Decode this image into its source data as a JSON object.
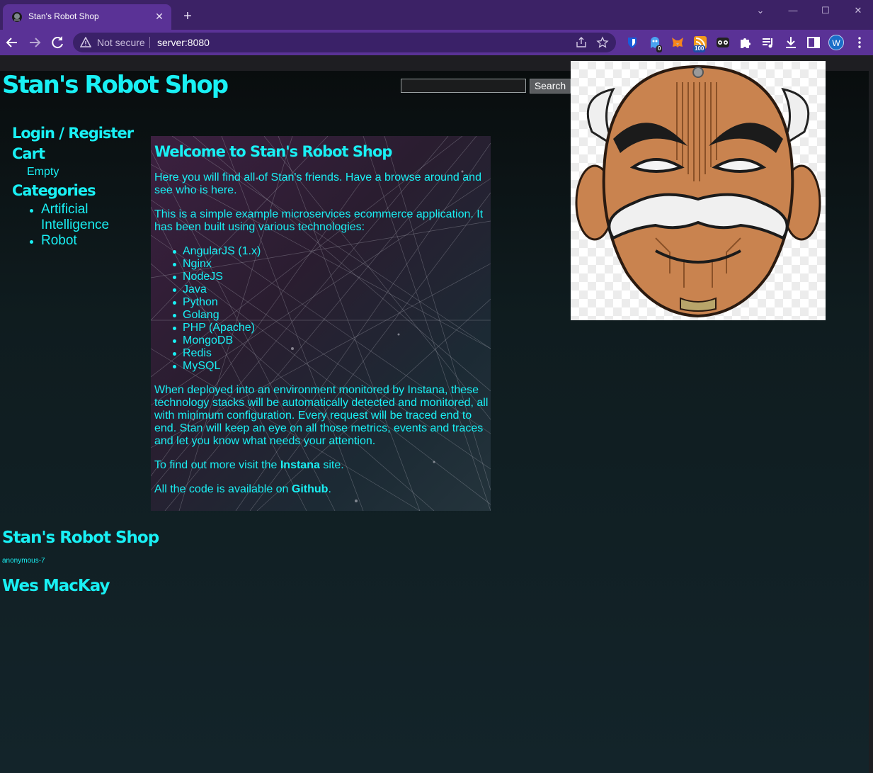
{
  "browser": {
    "tab_title": "Stan's Robot Shop",
    "security_label": "Not secure",
    "url": "server:8080",
    "profile_initial": "W",
    "extension_badges": {
      "ghostery": "0",
      "rss": "100"
    }
  },
  "header": {
    "title": "Stan's Robot Shop",
    "search_placeholder": "",
    "search_button": "Search"
  },
  "sidebar": {
    "login_label": "Login / Register",
    "cart_label": "Cart",
    "cart_status": "Empty",
    "categories_label": "Categories",
    "categories": [
      "Artificial Intelligence",
      "Robot"
    ]
  },
  "welcome": {
    "title": "Welcome to Stan's Robot Shop",
    "intro": "Here you will find all of Stan's friends. Have a browse around and see who is here.",
    "tech_intro": "This is a simple example microservices ecommerce application. It has been built using various technologies:",
    "technologies": [
      "AngularJS (1.x)",
      "Nginx",
      "NodeJS",
      "Java",
      "Python",
      "Golang",
      "PHP (Apache)",
      "MongoDB",
      "Redis",
      "MySQL"
    ],
    "monitoring": "When deployed into an environment monitored by Instana, these technology stacks will be automatically detected and monitored, all with minimum configuration. Every request will be traced end to end. Stan will keep an eye on all those metrics, events and traces and let you know what needs your attention.",
    "more_prefix": "To find out more visit the ",
    "more_link": "Instana",
    "more_suffix": " site.",
    "code_prefix": "All the code is available on ",
    "code_link": "Github",
    "code_suffix": "."
  },
  "footer": {
    "title": "Stan's Robot Shop",
    "user": "anonymous-7",
    "author": "Wes MacKay"
  },
  "colors": {
    "accent": "#19f0f4",
    "tab_bar": "#3c2266",
    "toolbar": "#5a3296",
    "mask_copper": "#c9834f"
  }
}
